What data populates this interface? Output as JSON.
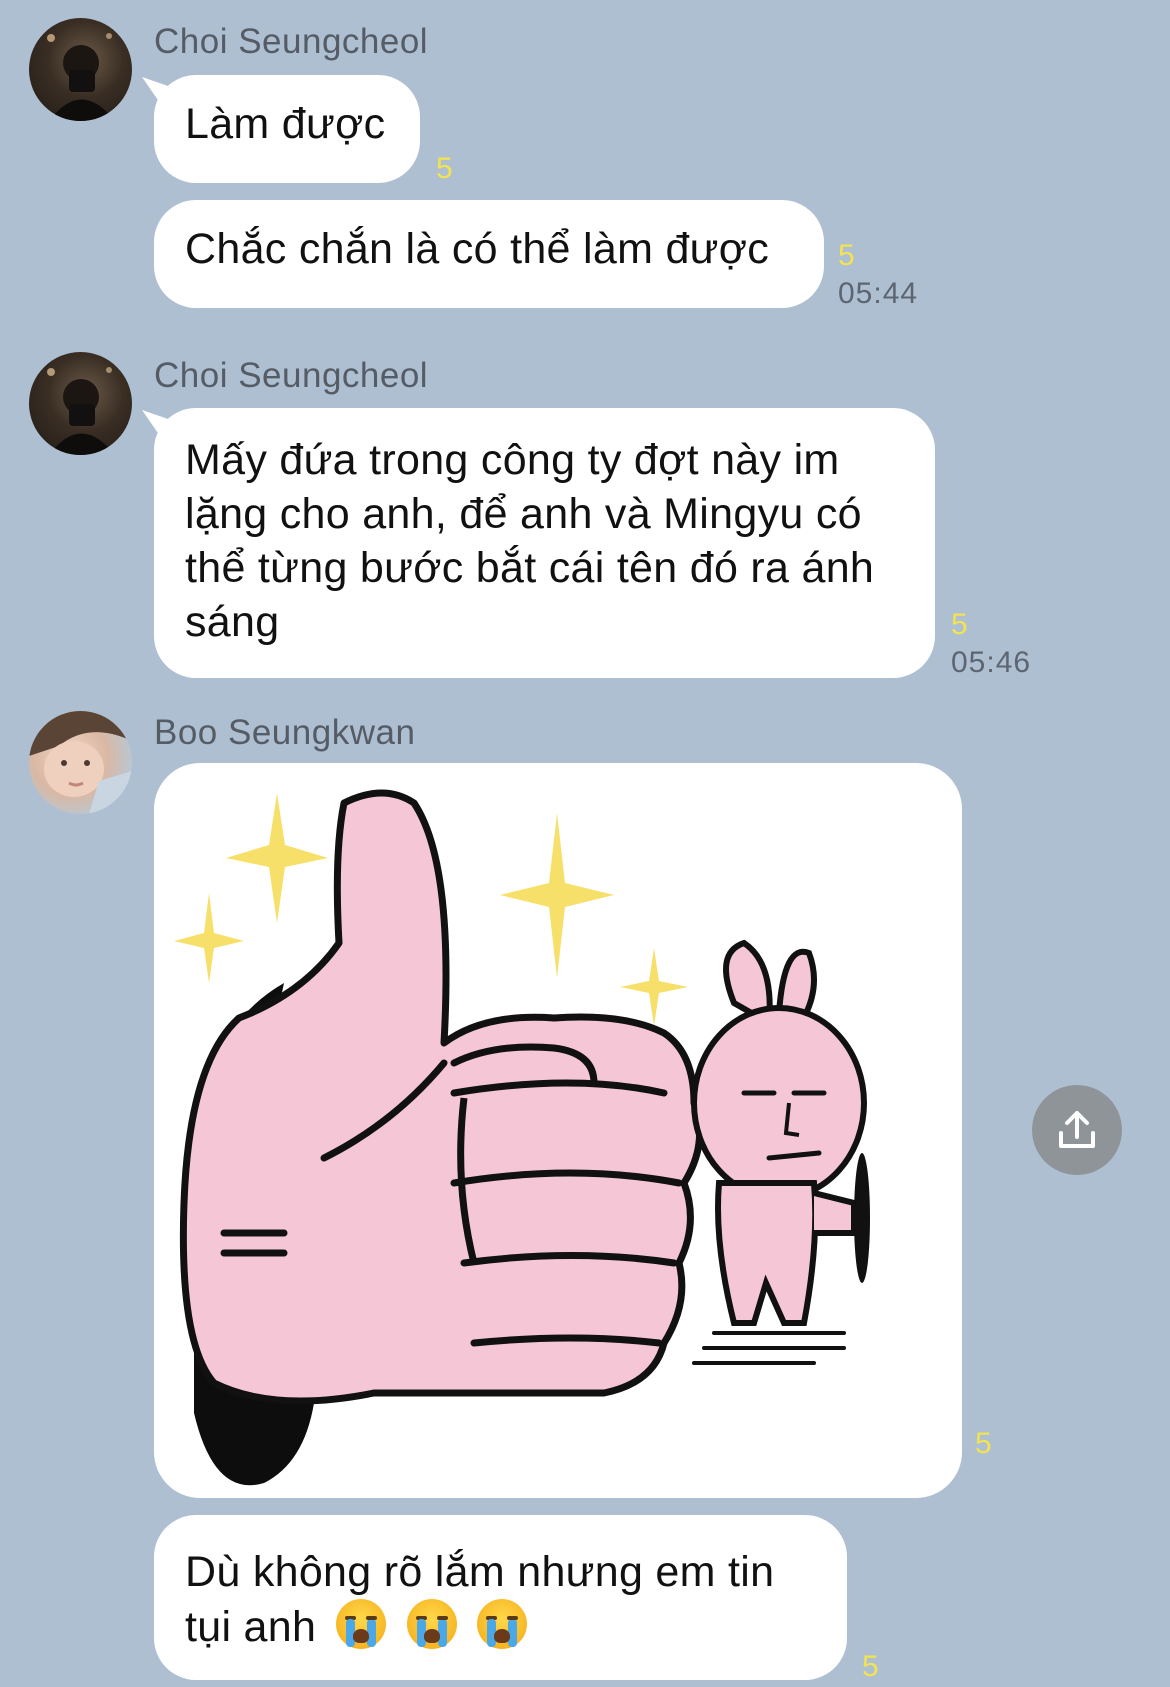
{
  "messages": [
    {
      "sender": "Choi Seungcheol",
      "bubbles": [
        {
          "text": "Làm được",
          "read": "5"
        },
        {
          "text": "Chắc chắn là có thể làm được",
          "read": "5",
          "time": "05:44"
        }
      ]
    },
    {
      "sender": "Choi Seungcheol",
      "bubbles": [
        {
          "text": "Mấy đứa trong công ty đợt này im lặng cho anh, để anh và Mingyu có thể từng bước bắt cái tên đó ra ánh sáng",
          "read": "5",
          "time": "05:46"
        }
      ]
    },
    {
      "sender": "Boo Seungkwan",
      "sticker": {
        "description": "thumbs-up-sticker",
        "read": "5"
      },
      "bubbles": [
        {
          "text": "Dù không rõ lắm nhưng em tin tụi anh",
          "emoji": [
            "crying-face",
            "crying-face",
            "crying-face"
          ],
          "read": "5"
        }
      ]
    }
  ],
  "colors": {
    "background": "#aebfd1",
    "bubble": "#ffffff",
    "read_count": "#f2e352",
    "sticker_pink": "#f5c7d6",
    "sparkle": "#f7e06a"
  },
  "icons": {
    "share": "share-upload-icon"
  }
}
